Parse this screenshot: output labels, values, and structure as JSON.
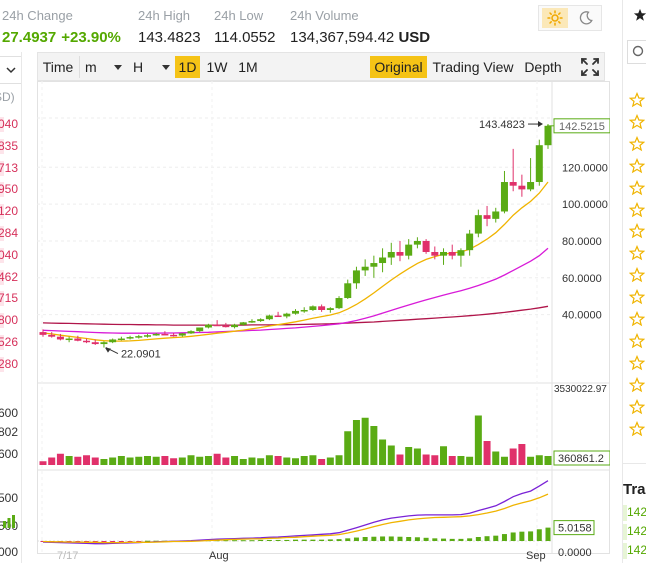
{
  "header": {
    "change_label": "24h Change",
    "change_value": "27.4937",
    "change_pct": "+23.90%",
    "high_label": "24h High",
    "high_value": "143.4823",
    "low_label": "24h Low",
    "low_value": "114.0552",
    "volume_label": "24h Volume",
    "volume_value": "134,367,594.42",
    "volume_currency": "USD"
  },
  "theme": {
    "light_icon": "sun-icon",
    "dark_icon": "moon-icon",
    "active": "light"
  },
  "order_book_strip": {
    "dropdown_icon": "chevron-down-icon",
    "header": "SD)",
    "asks": [
      "040",
      "835",
      "713",
      "950",
      "120",
      "284",
      "040",
      "462",
      "715",
      "800",
      "526",
      "280"
    ],
    "bids": [
      "600",
      "802",
      "600",
      "500",
      "500",
      "000"
    ]
  },
  "toolbar": {
    "time_label": "Time",
    "minute_label": "m",
    "hour_label": "H",
    "day_label": "1D",
    "week_label": "1W",
    "month_label": "1M",
    "original_label": "Original",
    "tradingview_label": "Trading View",
    "depth_label": "Depth",
    "expand_icon": "expand-icon",
    "active_interval": "1D",
    "active_view": "Original"
  },
  "colors": {
    "up": "#5aab14",
    "down": "#e0306a",
    "accent": "#f5c316",
    "ma_short": "#f0b400",
    "ma_mid": "#d81bd8",
    "ma_long": "#b0154a",
    "macd_dif": "#f0b400",
    "macd_dea": "#7a22d6"
  },
  "chart_data": {
    "type": "candlestick",
    "x_tick_labels": [
      "7/17",
      "Aug",
      "Sep"
    ],
    "price_axis_ticks": [
      "120.0000",
      "100.0000",
      "80.0000",
      "60.0000",
      "40.0000"
    ],
    "price_ylim": [
      11,
      156
    ],
    "last_price_tag": "142.5215",
    "max_marker": "143.4823",
    "min_marker": "22.0901",
    "volume_axis_top": "3530022.97",
    "volume_last_tag": "360861.2",
    "macd_last_tag": "5.0158",
    "macd_zero_tick": "0.0000",
    "candles": [
      [
        30.5,
        32,
        28,
        29
      ],
      [
        29,
        30.5,
        27.5,
        28
      ],
      [
        28,
        29.5,
        26,
        26.5
      ],
      [
        26.5,
        28,
        25,
        27
      ],
      [
        27,
        28.5,
        25.5,
        25.8
      ],
      [
        25.8,
        27,
        24.5,
        25
      ],
      [
        25,
        26.5,
        23.5,
        24
      ],
      [
        24,
        25.5,
        22.0901,
        25
      ],
      [
        25,
        27,
        24.5,
        26.5
      ],
      [
        26.5,
        28,
        26,
        27
      ],
      [
        27,
        28.5,
        26.5,
        27.8
      ],
      [
        27.8,
        29,
        27,
        28.3
      ],
      [
        28.3,
        29.5,
        27.5,
        28.8
      ],
      [
        28.8,
        30,
        28.5,
        29.5
      ],
      [
        29.5,
        31,
        29,
        29
      ],
      [
        29,
        30,
        28,
        28.6
      ],
      [
        28.6,
        30,
        28,
        29.8
      ],
      [
        29.8,
        31.5,
        29.5,
        31
      ],
      [
        31,
        33,
        30.5,
        33
      ],
      [
        33,
        35,
        32.5,
        34.5
      ],
      [
        34.5,
        37,
        34,
        34
      ],
      [
        34,
        35.5,
        33,
        33.2
      ],
      [
        33.2,
        35,
        32.5,
        34.5
      ],
      [
        34.5,
        36,
        34,
        35.8
      ],
      [
        35.8,
        37.5,
        35.5,
        36.5
      ],
      [
        36.5,
        38,
        36,
        37.5
      ],
      [
        37.5,
        40,
        37,
        39.5
      ],
      [
        39.5,
        41.5,
        39,
        39
      ],
      [
        39,
        41,
        38,
        40.5
      ],
      [
        40.5,
        43,
        40,
        42
      ],
      [
        42,
        44,
        41,
        42.5
      ],
      [
        42.5,
        45,
        42,
        44.5
      ],
      [
        44.5,
        45.5,
        41.5,
        42.5
      ],
      [
        42.5,
        44,
        41,
        43.5
      ],
      [
        43.5,
        50,
        43,
        49
      ],
      [
        49,
        59,
        48.5,
        57
      ],
      [
        57,
        66,
        54,
        64
      ],
      [
        64,
        70,
        61,
        66
      ],
      [
        66,
        72,
        60,
        68
      ],
      [
        68,
        76,
        63,
        71
      ],
      [
        71,
        79,
        67,
        74
      ],
      [
        74,
        80,
        69,
        72
      ],
      [
        72,
        81,
        70,
        78
      ],
      [
        78,
        82,
        76,
        80
      ],
      [
        80,
        81,
        73,
        74
      ],
      [
        74,
        77,
        70,
        72
      ],
      [
        72,
        76,
        67,
        74
      ],
      [
        74,
        78,
        70,
        72
      ],
      [
        72,
        76,
        66,
        75
      ],
      [
        75,
        86,
        72,
        84
      ],
      [
        84,
        97,
        82,
        94
      ],
      [
        94,
        99,
        88,
        92
      ],
      [
        92,
        98,
        90,
        96
      ],
      [
        96,
        118,
        95,
        112
      ],
      [
        112,
        130,
        107,
        110
      ],
      [
        110,
        116,
        104,
        108
      ],
      [
        108,
        125,
        107,
        112
      ],
      [
        112,
        135,
        110,
        132
      ],
      [
        132,
        143.4823,
        130,
        142.5215
      ]
    ],
    "volumes": [
      0.05,
      0.1,
      0.15,
      0.12,
      0.11,
      0.13,
      0.1,
      0.08,
      0.1,
      0.12,
      0.1,
      0.11,
      0.12,
      0.11,
      0.12,
      0.09,
      0.1,
      0.13,
      0.11,
      0.12,
      0.15,
      0.1,
      0.12,
      0.08,
      0.1,
      0.09,
      0.13,
      0.12,
      0.1,
      0.09,
      0.12,
      0.13,
      0.08,
      0.1,
      0.13,
      0.45,
      0.6,
      0.63,
      0.52,
      0.34,
      0.26,
      0.14,
      0.24,
      0.22,
      0.14,
      0.13,
      0.25,
      0.12,
      0.12,
      0.11,
      0.66,
      0.32,
      0.18,
      0.11,
      0.22,
      0.28,
      0.11,
      0.13,
      0.12
    ],
    "ma_short": [
      30,
      29.5,
      28.8,
      28.2,
      27.6,
      27.0,
      26.3,
      25.8,
      25.6,
      25.6,
      25.7,
      26.0,
      26.4,
      26.8,
      27.2,
      27.5,
      27.8,
      28.2,
      28.7,
      29.3,
      29.9,
      30.4,
      31.0,
      31.6,
      32.3,
      33.0,
      33.8,
      34.5,
      35.3,
      36.1,
      37.0,
      38.0,
      38.9,
      39.8,
      41.0,
      43.0,
      45.5,
      48.5,
      51.8,
      55.3,
      58.8,
      62.0,
      65.0,
      67.8,
      70.0,
      71.5,
      72.8,
      73.5,
      74.0,
      75.5,
      78.0,
      81.0,
      84.5,
      89.0,
      94.0,
      98.0,
      101.5,
      106.0,
      112.0
    ],
    "ma_mid": [
      31.5,
      31.3,
      31.1,
      30.9,
      30.7,
      30.5,
      30.3,
      30.1,
      30.0,
      29.9,
      29.9,
      29.9,
      29.9,
      29.9,
      30.0,
      30.0,
      30.1,
      30.2,
      30.3,
      30.4,
      30.6,
      30.8,
      31.0,
      31.2,
      31.4,
      31.6,
      31.9,
      32.2,
      32.5,
      32.8,
      33.2,
      33.6,
      34.0,
      34.5,
      35.0,
      35.8,
      36.8,
      38.0,
      39.3,
      40.8,
      42.3,
      43.8,
      45.2,
      46.6,
      48.0,
      49.3,
      50.6,
      51.8,
      53.0,
      54.3,
      55.8,
      57.5,
      59.3,
      61.5,
      64.0,
      66.5,
      69.0,
      72.0,
      76.0
    ],
    "ma_long": [
      35.5,
      35.4,
      35.3,
      35.2,
      35.1,
      35.0,
      34.9,
      34.8,
      34.7,
      34.6,
      34.6,
      34.5,
      34.5,
      34.4,
      34.4,
      34.3,
      34.3,
      34.3,
      34.3,
      34.3,
      34.3,
      34.3,
      34.3,
      34.3,
      34.4,
      34.4,
      34.4,
      34.5,
      34.5,
      34.6,
      34.7,
      34.8,
      34.9,
      35.0,
      35.2,
      35.4,
      35.6,
      35.8,
      36.0,
      36.3,
      36.6,
      36.9,
      37.2,
      37.5,
      37.8,
      38.1,
      38.4,
      38.7,
      39.0,
      39.4,
      39.8,
      40.2,
      40.7,
      41.2,
      41.8,
      42.4,
      43.0,
      43.7,
      44.5
    ],
    "macd_hist": [
      -0.2,
      -0.2,
      -0.3,
      -0.3,
      -0.4,
      -0.4,
      -0.5,
      -0.4,
      -0.3,
      -0.2,
      -0.2,
      -0.1,
      0.1,
      0.1,
      0.1,
      0.1,
      0.2,
      0.2,
      0.3,
      0.3,
      0.3,
      0.3,
      0.3,
      0.3,
      0.3,
      0.4,
      0.4,
      0.4,
      0.4,
      0.5,
      0.5,
      0.5,
      0.5,
      0.6,
      0.7,
      1.0,
      1.3,
      1.5,
      1.6,
      1.7,
      1.7,
      1.6,
      1.5,
      1.4,
      1.2,
      1.0,
      0.9,
      0.8,
      0.8,
      1.0,
      1.5,
      1.8,
      2.0,
      2.6,
      3.2,
      3.5,
      3.6,
      4.4,
      5.0158
    ],
    "macd_dif": [
      -0.4,
      -0.5,
      -0.6,
      -0.7,
      -0.8,
      -0.9,
      -1.0,
      -1.0,
      -0.9,
      -0.8,
      -0.7,
      -0.6,
      -0.4,
      -0.3,
      -0.2,
      -0.1,
      0,
      0.1,
      0.3,
      0.5,
      0.7,
      0.8,
      0.9,
      1.0,
      1.1,
      1.2,
      1.4,
      1.5,
      1.7,
      1.9,
      2.1,
      2.3,
      2.5,
      2.7,
      3.1,
      4.0,
      5.0,
      6.0,
      7.0,
      7.9,
      8.6,
      9.0,
      9.4,
      9.7,
      9.8,
      9.8,
      9.8,
      9.8,
      9.9,
      10.4,
      11.4,
      12.3,
      13.2,
      14.8,
      16.6,
      17.8,
      18.7,
      20.6,
      22.6
    ],
    "macd_dea": [
      -0.2,
      -0.3,
      -0.3,
      -0.4,
      -0.4,
      -0.5,
      -0.5,
      -0.6,
      -0.6,
      -0.6,
      -0.5,
      -0.5,
      -0.5,
      -0.4,
      -0.3,
      -0.2,
      -0.2,
      -0.1,
      0,
      0.2,
      0.3,
      0.5,
      0.6,
      0.7,
      0.8,
      0.8,
      1.0,
      1.1,
      1.3,
      1.4,
      1.6,
      1.8,
      2.0,
      2.1,
      2.4,
      3.0,
      3.7,
      4.5,
      5.4,
      6.2,
      6.9,
      7.4,
      7.9,
      8.3,
      8.6,
      8.8,
      8.9,
      9.0,
      9.1,
      9.4,
      9.9,
      10.5,
      11.2,
      12.2,
      13.4,
      14.3,
      15.1,
      16.2,
      17.6
    ]
  },
  "market_strip": {
    "tab_icon": "star-filled-icon",
    "search_icon": "search-icon",
    "row_icon": "star-icon",
    "row_count": 16,
    "trades_title": "Tra",
    "trades": [
      "142",
      "142",
      "142"
    ]
  }
}
